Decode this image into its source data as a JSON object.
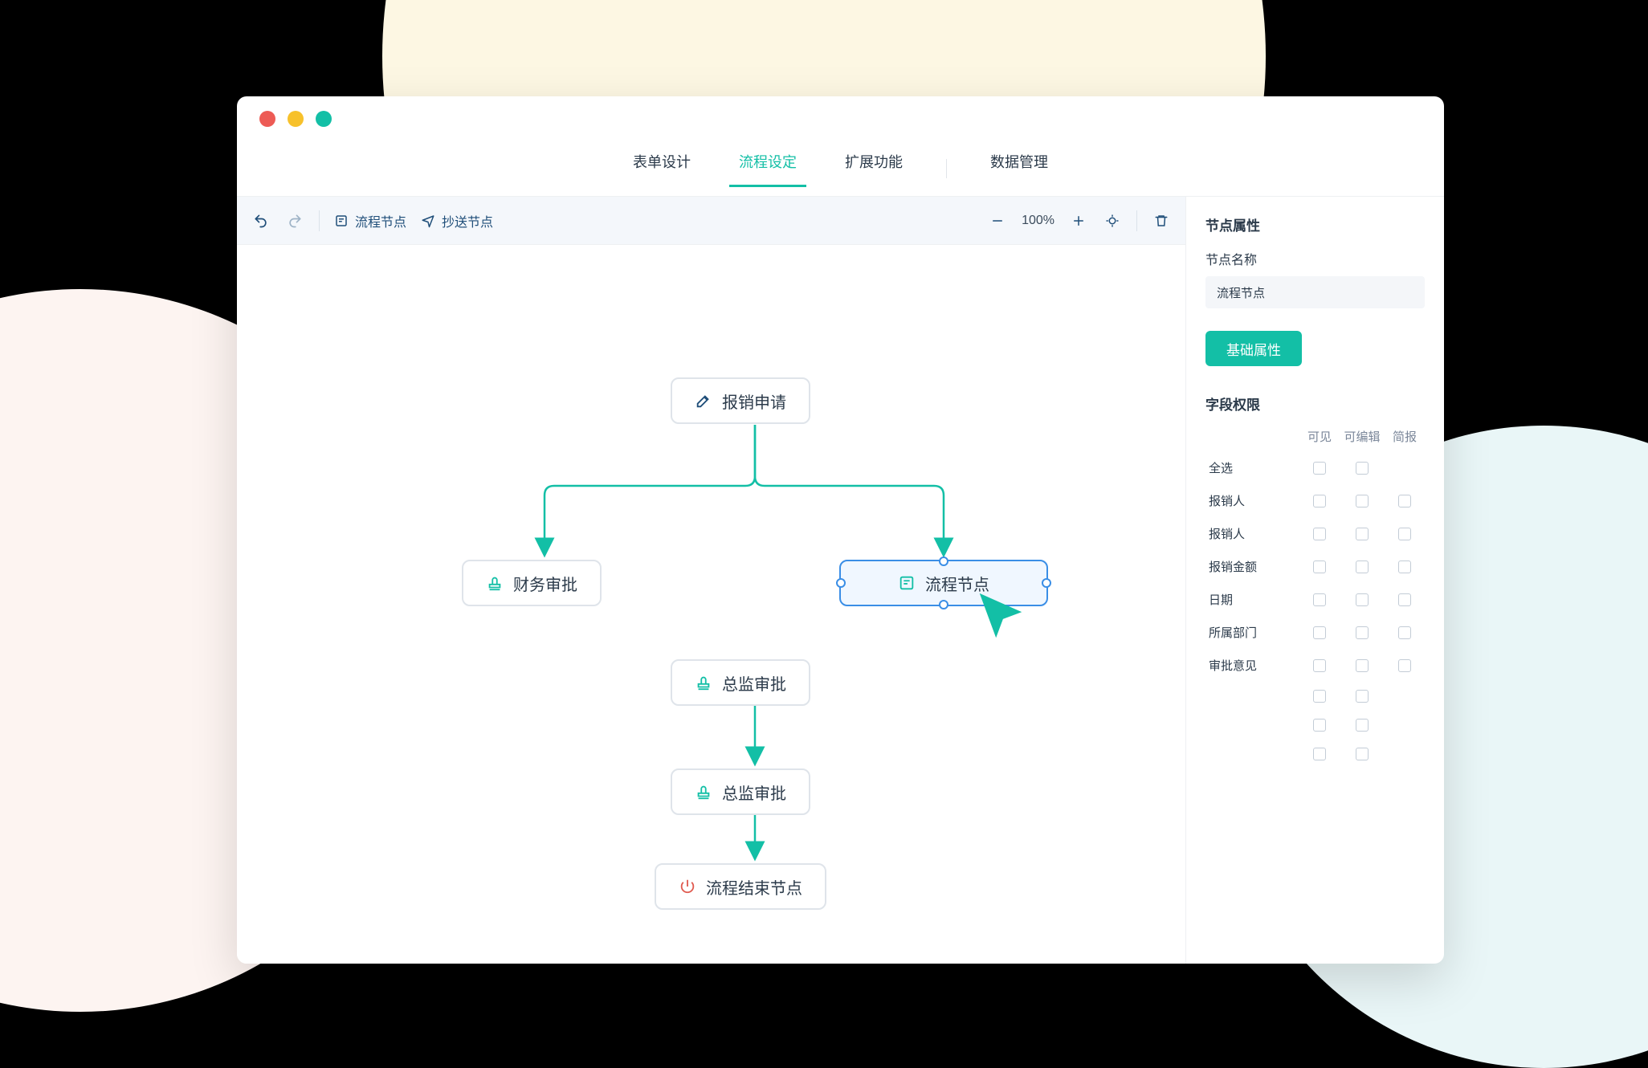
{
  "tabs": {
    "items": [
      "表单设计",
      "流程设定",
      "扩展功能",
      "数据管理"
    ],
    "active": 1,
    "divider_after": 2
  },
  "toolbar": {
    "labels": {
      "process": "流程节点",
      "cc": "抄送节点"
    },
    "zoom": "100%"
  },
  "nodes": {
    "start": {
      "label": "报销申请"
    },
    "finance": {
      "label": "财务审批"
    },
    "process": {
      "label": "流程节点"
    },
    "director": {
      "label": "总监审批"
    },
    "end": {
      "label": "流程结束节点"
    }
  },
  "sidebar": {
    "title": "节点属性",
    "name_label": "节点名称",
    "name_value": "流程节点",
    "btn_basic": "基础属性",
    "perm_title": "字段权限",
    "perm_cols": [
      "可见",
      "可编辑",
      "简报"
    ],
    "perm_rows_full": [
      "全选",
      "报销人",
      "报销人",
      "报销金额",
      "日期",
      "所属部门",
      "审批意见"
    ],
    "perm_rows_2col_count": 3
  },
  "colors": {
    "accent": "#13bfa6",
    "select": "#3a8ee6",
    "danger": "#e05a4f"
  }
}
